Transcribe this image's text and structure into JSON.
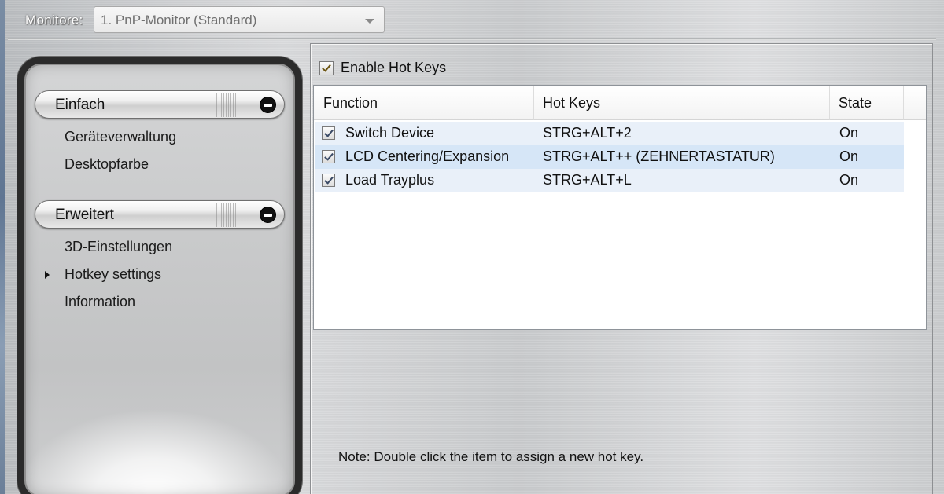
{
  "monitor": {
    "label": "Monitore:",
    "selected": "1. PnP-Monitor (Standard)"
  },
  "nav": {
    "sections": [
      {
        "title": "Einfach",
        "items": [
          "Geräteverwaltung",
          "Desktopfarbe"
        ]
      },
      {
        "title": "Erweitert",
        "items": [
          "3D-Einstellungen",
          "Hotkey settings",
          "Information"
        ]
      }
    ],
    "active_item": "Hotkey settings"
  },
  "hotkeys": {
    "enable_label": "Enable Hot Keys",
    "enabled": true,
    "columns": [
      "Function",
      "Hot Keys",
      "State"
    ],
    "rows": [
      {
        "function": "Switch Device",
        "keys": "STRG+ALT+2",
        "state": "On",
        "checked": true
      },
      {
        "function": "LCD Centering/Expansion",
        "keys": "STRG+ALT++ (ZEHNERTASTATUR)",
        "state": "On",
        "checked": true
      },
      {
        "function": "Load Trayplus",
        "keys": "STRG+ALT+L",
        "state": "On",
        "checked": true
      }
    ],
    "note": "Note: Double click the item to assign a new hot key."
  },
  "colors": {
    "row_alt": "#e9f0f9",
    "row_selected": "#d6e6f7",
    "panel_frame": "#2b2b2b"
  }
}
